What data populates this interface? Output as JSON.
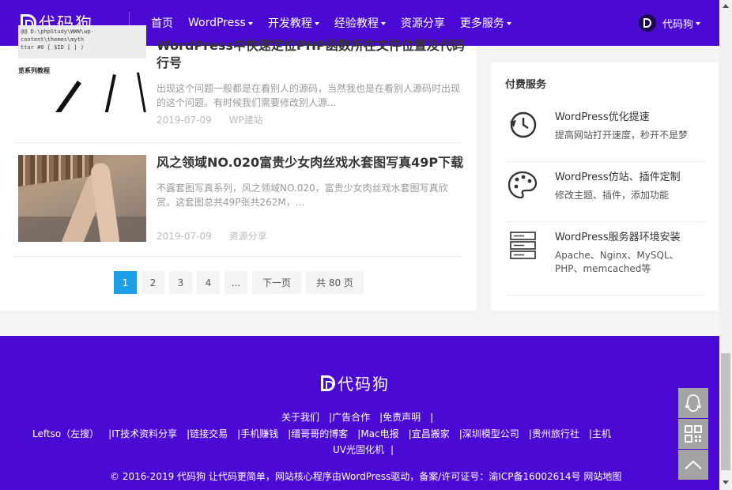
{
  "header": {
    "logo_text": "代码狗",
    "nav": [
      {
        "label": "首页",
        "dropdown": false
      },
      {
        "label": "WordPress",
        "dropdown": true
      },
      {
        "label": "开发教程",
        "dropdown": true
      },
      {
        "label": "经验教程",
        "dropdown": true
      },
      {
        "label": "资源分享",
        "dropdown": false
      },
      {
        "label": "更多服务",
        "dropdown": true
      }
    ],
    "user_name": "代码狗"
  },
  "posts": [
    {
      "title_line1": "WordPress中快速定位PHP函数所在文件位置及代码",
      "title_line2": "行号",
      "excerpt": "出现这个问题一般都是在看别人的源码，当然我也是在看别人源码时出现的这个问题。有时候我们需要修改别人源...",
      "date": "2019-07-09",
      "category": "WP建站",
      "thumb_code_lines": [
        "@@ D:\\phpStudy\\WWW\\wp-content\\themes\\myth",
        "ttor #0 [ $ID [ ] )"
      ],
      "thumb_caption": "览系列教程"
    },
    {
      "title": "风之领域NO.020富贵少女肉丝戏水套图写真49P下载",
      "excerpt": "不露套图写真系列，风之领域NO.020，富贵少女肉丝戏水套图写真欣赏。这套图总共49P张共262M，...",
      "date": "2019-07-09",
      "category": "资源分享"
    }
  ],
  "pagination": {
    "pages": [
      "1",
      "2",
      "3",
      "4",
      "..."
    ],
    "active": "1",
    "next": "下一页",
    "total": "共 80 页"
  },
  "sidebar": {
    "title": "付费服务",
    "services": [
      {
        "icon": "speed-clock-icon",
        "title": "WordPress优化提速",
        "desc": "提高网站打开速度，秒开不是梦"
      },
      {
        "icon": "palette-icon",
        "title": "WordPress仿站、插件定制",
        "desc": "修改主题、插件，添加功能"
      },
      {
        "icon": "server-rack-icon",
        "title": "WordPress服务器环境安装",
        "desc": "Apache、Nginx、MySQL、PHP、memcached等"
      }
    ]
  },
  "footer": {
    "logo_text": "代码狗",
    "links_row1": [
      "关于我们",
      "广告合作",
      "免责声明"
    ],
    "links_row2": [
      "Leftso（左搜）",
      "IT技术资料分享",
      "链接交易",
      "手机赚钱",
      "缙哥哥的博客",
      "Mac电报",
      "宜昌搬家",
      "深圳模型公司",
      "贵州旅行社",
      "主机"
    ],
    "links_row3": [
      "UV光固化机"
    ],
    "copyright": "© 2016-2019   代码狗 让代码更简单，网站核心程序由WordPress驱动，备案/许可证号：渝ICP备16002614号 网站地图"
  },
  "colors": {
    "brand": "#4b09d4",
    "pager_active": "#1ea0e8"
  }
}
